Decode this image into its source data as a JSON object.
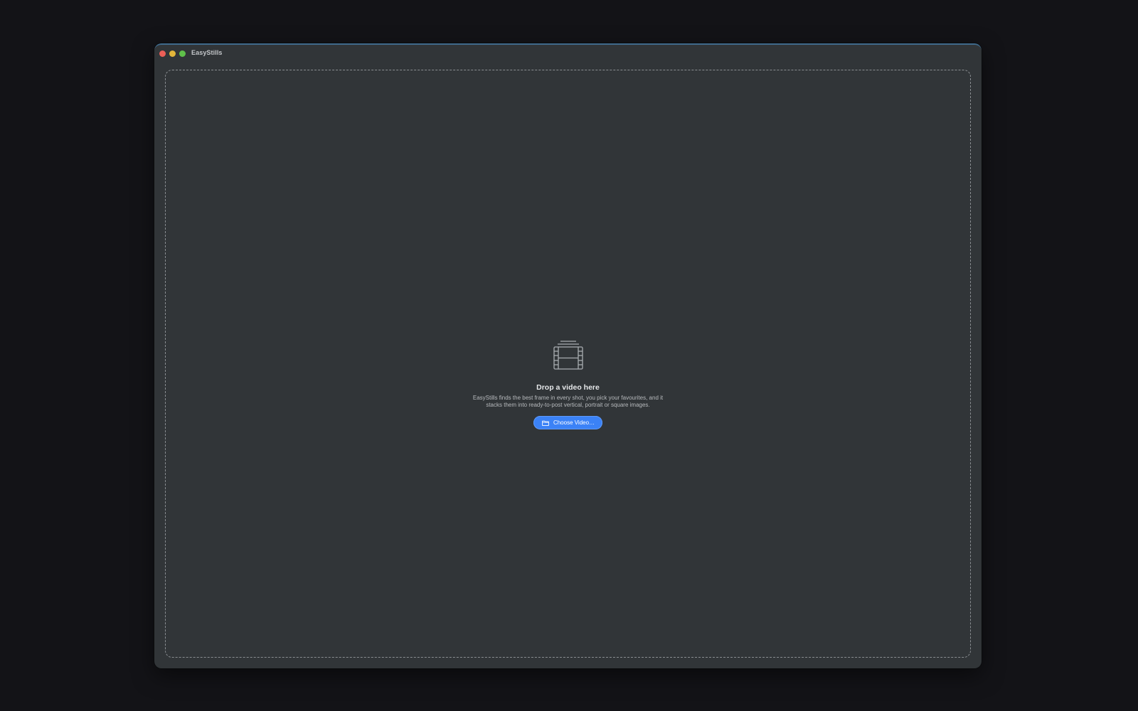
{
  "window": {
    "title": "EasyStills"
  },
  "dropzone": {
    "icon": "film-stack-icon",
    "headline": "Drop a video here",
    "description": "EasyStills finds the best frame in every shot, you pick your favourites, and it stacks them into ready-to-post vertical, portrait or square images.",
    "button_icon": "folder-icon",
    "button_label": "Choose Video…"
  },
  "colors": {
    "accent": "#3b82f6",
    "close": "#ec5f57",
    "minimize": "#e2b53a",
    "zoom": "#5fc04a"
  }
}
